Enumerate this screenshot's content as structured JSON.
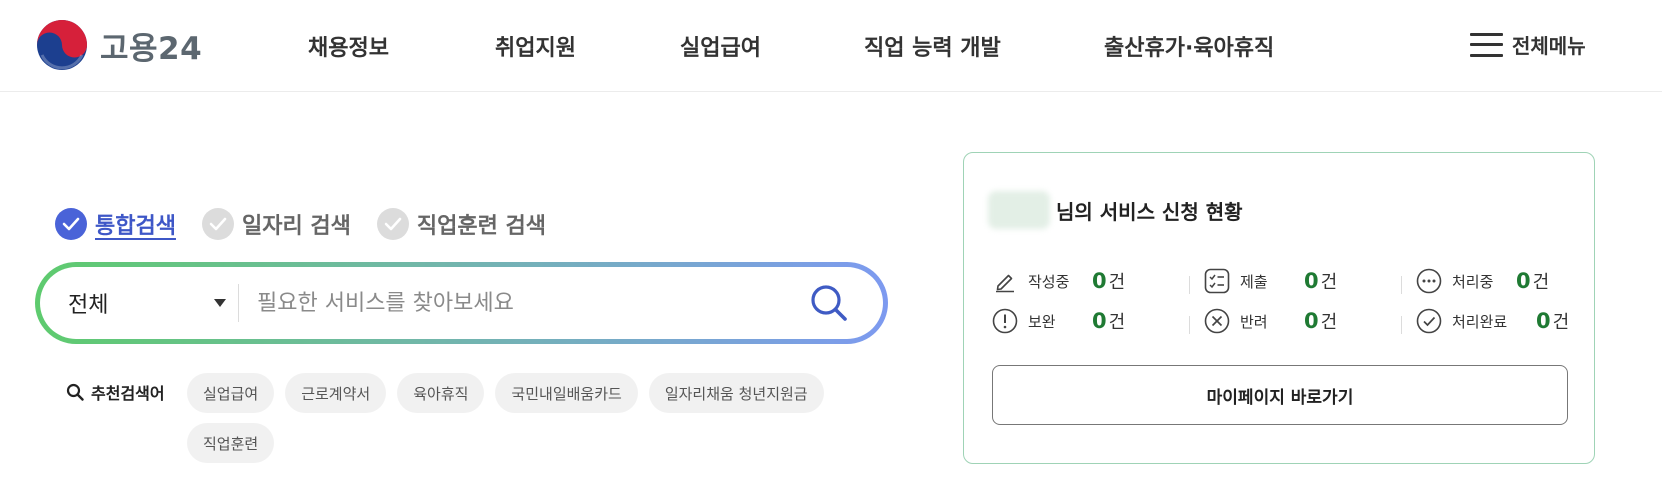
{
  "header": {
    "logo_text": "고용24",
    "nav": [
      "채용정보",
      "취업지원",
      "실업급여",
      "직업 능력 개발",
      "출산휴가·육아휴직"
    ],
    "all_menu_label": "전체메뉴"
  },
  "search": {
    "types": [
      {
        "label": "통합검색",
        "selected": true
      },
      {
        "label": "일자리 검색",
        "selected": false
      },
      {
        "label": "직업훈련 검색",
        "selected": false
      }
    ],
    "category_value": "전체",
    "placeholder": "필요한 서비스를 찾아보세요",
    "gradient_colors": [
      "#5ecb6e",
      "#7d9af0"
    ]
  },
  "recommended": {
    "label": "추천검색어",
    "keywords": [
      "실업급여",
      "근로계약서",
      "육아휴직",
      "국민내일배움카드",
      "일자리채움 청년지원금",
      "직업훈련"
    ]
  },
  "status_card": {
    "title": "님의 서비스 신청 현황",
    "items": [
      {
        "icon": "pencil-icon",
        "label": "작성중",
        "count": "0",
        "unit": "건"
      },
      {
        "icon": "checklist-icon",
        "label": "제출",
        "count": "0",
        "unit": "건"
      },
      {
        "icon": "ellipsis-circle-icon",
        "label": "처리중",
        "count": "0",
        "unit": "건"
      },
      {
        "icon": "exclamation-circle-icon",
        "label": "보완",
        "count": "0",
        "unit": "건"
      },
      {
        "icon": "x-circle-icon",
        "label": "반려",
        "count": "0",
        "unit": "건"
      },
      {
        "icon": "check-circle-icon",
        "label": "처리완료",
        "count": "0",
        "unit": "건"
      }
    ],
    "mypage_button": "마이페이지 바로가기",
    "count_color": "#1f7a33",
    "border_color": "#9fd3b6"
  }
}
